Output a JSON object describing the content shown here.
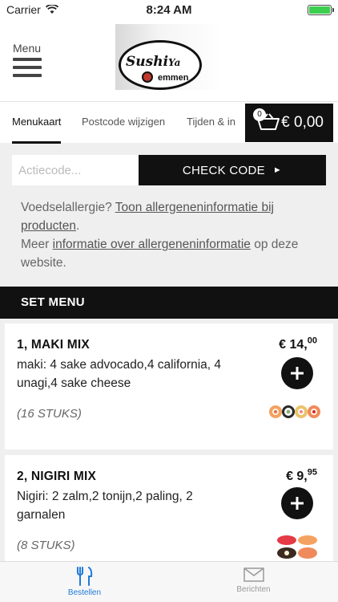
{
  "status_bar": {
    "carrier": "Carrier",
    "time": "8:24 AM"
  },
  "header": {
    "menu_label": "Menu",
    "logo_text": "Sushi",
    "logo_text_2": "Ya",
    "logo_sub": "emmen"
  },
  "tabs": [
    {
      "label": "Menukaart",
      "active": true
    },
    {
      "label": "Postcode wijzigen",
      "active": false
    },
    {
      "label": "Tijden & in",
      "active": false
    }
  ],
  "cart": {
    "count": "0",
    "total": "€ 0,00"
  },
  "promo": {
    "placeholder": "Actiecode...",
    "button_label": "CHECK CODE",
    "button_arrow": "►"
  },
  "allergy": {
    "line1_prefix": "Voedselallergie? ",
    "line1_link": "Toon allergeneninformatie bij producten",
    "line1_suffix": ".",
    "line2_prefix": "Meer ",
    "line2_link": "informatie over allergeneninformatie",
    "line2_suffix": " op deze website."
  },
  "section": {
    "title": "SET MENU"
  },
  "products": [
    {
      "title": "1, MAKI MIX",
      "description": "maki: 4 sake advocado,4 california, 4 unagi,4 sake cheese",
      "count": "(16 STUKS)",
      "price_main": "€ 14,",
      "price_cents": "00"
    },
    {
      "title": "2, NIGIRI MIX",
      "description": "Nigiri: 2 zalm,2 tonijn,2 paling, 2 garnalen",
      "count": "(8 STUKS)",
      "price_main": "€ 9,",
      "price_cents": "95"
    }
  ],
  "tabbar": [
    {
      "label": "Bestellen",
      "icon": "cutlery-icon",
      "active": true
    },
    {
      "label": "Berichten",
      "icon": "envelope-icon",
      "active": false
    }
  ],
  "colors": {
    "primary": "#111111",
    "active_tab": "#1f7ad8",
    "background": "#efefef"
  }
}
